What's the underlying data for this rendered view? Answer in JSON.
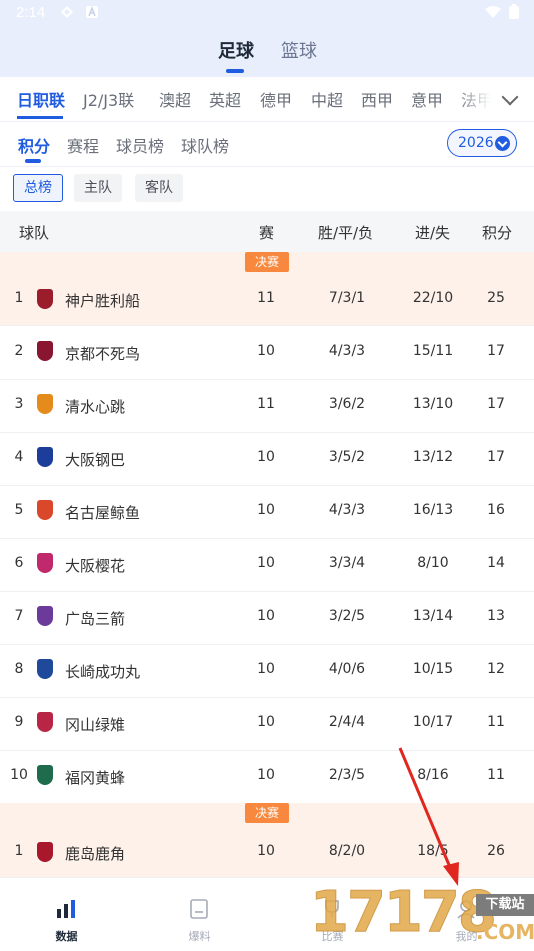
{
  "status_bar": {
    "time": "2:14"
  },
  "sport_tabs": [
    {
      "label": "足球",
      "active": true
    },
    {
      "label": "篮球",
      "active": false
    }
  ],
  "leagues": [
    "日职联",
    "J2/J3联",
    "澳超",
    "英超",
    "德甲",
    "中超",
    "西甲",
    "意甲",
    "法甲"
  ],
  "active_league": "日职联",
  "sub_tabs": [
    "积分",
    "赛程",
    "球员榜",
    "球队榜"
  ],
  "season": "2026",
  "filters": [
    "总榜",
    "主队",
    "客队"
  ],
  "table_header": {
    "team": "球队",
    "games": "赛",
    "wdl": "胜/平/负",
    "goals": "进/失",
    "points": "积分"
  },
  "badge_label": "决赛",
  "group1": [
    {
      "rank": "1",
      "name": "神户胜利船",
      "games": "11",
      "wdl": "7/3/1",
      "goals": "22/10",
      "points": "25",
      "logo_color": "#9b1c2a"
    },
    {
      "rank": "2",
      "name": "京都不死鸟",
      "games": "10",
      "wdl": "4/3/3",
      "goals": "15/11",
      "points": "17",
      "logo_color": "#8a1530"
    },
    {
      "rank": "3",
      "name": "清水心跳",
      "games": "11",
      "wdl": "3/6/2",
      "goals": "13/10",
      "points": "17",
      "logo_color": "#e58b1b"
    },
    {
      "rank": "4",
      "name": "大阪钢巴",
      "games": "10",
      "wdl": "3/5/2",
      "goals": "13/12",
      "points": "17",
      "logo_color": "#1d3d9a"
    },
    {
      "rank": "5",
      "name": "名古屋鲸鱼",
      "games": "10",
      "wdl": "4/3/3",
      "goals": "16/13",
      "points": "16",
      "logo_color": "#d9482b"
    },
    {
      "rank": "6",
      "name": "大阪樱花",
      "games": "10",
      "wdl": "3/3/4",
      "goals": "8/10",
      "points": "14",
      "logo_color": "#c0296b"
    },
    {
      "rank": "7",
      "name": "广岛三箭",
      "games": "10",
      "wdl": "3/2/5",
      "goals": "13/14",
      "points": "13",
      "logo_color": "#6b3a9a"
    },
    {
      "rank": "8",
      "name": "长崎成功丸",
      "games": "10",
      "wdl": "4/0/6",
      "goals": "10/15",
      "points": "12",
      "logo_color": "#1f4a9b"
    },
    {
      "rank": "9",
      "name": "冈山绿雉",
      "games": "10",
      "wdl": "2/4/4",
      "goals": "10/17",
      "points": "11",
      "logo_color": "#b82545"
    },
    {
      "rank": "10",
      "name": "福冈黄蜂",
      "games": "10",
      "wdl": "2/3/5",
      "goals": "8/16",
      "points": "11",
      "logo_color": "#1f6b4e"
    }
  ],
  "group2": [
    {
      "rank": "1",
      "name": "鹿岛鹿角",
      "games": "10",
      "wdl": "8/2/0",
      "goals": "18/5",
      "points": "26",
      "logo_color": "#a8172c"
    }
  ],
  "bottom_nav": [
    {
      "label": "数据",
      "icon": "bar-chart-icon",
      "active": true
    },
    {
      "label": "爆料",
      "icon": "document-icon",
      "active": false
    },
    {
      "label": "比赛",
      "icon": "trophy-icon",
      "active": false
    },
    {
      "label": "我的",
      "icon": "user-icon",
      "active": false
    }
  ],
  "watermark": {
    "main": "17178",
    "sub1": "下载站",
    "sub2": ".COM"
  },
  "colors": {
    "accent": "#1f5ce0",
    "highlight_row": "#fdf1ea",
    "badge": "#f7883d"
  }
}
